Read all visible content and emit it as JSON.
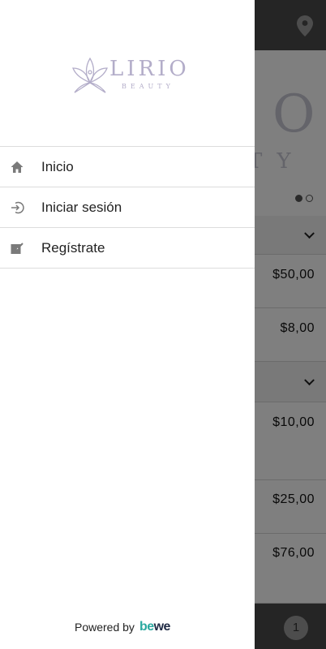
{
  "drawer": {
    "logo_text": "LIRIO",
    "logo_sub": "BEAUTY",
    "menu": [
      {
        "label": "Inicio",
        "icon": "home-icon"
      },
      {
        "label": "Iniciar sesión",
        "icon": "login-icon"
      },
      {
        "label": "Regístrate",
        "icon": "register-icon"
      }
    ],
    "powered_by": "Powered by",
    "brand_a": "be",
    "brand_b": "we"
  },
  "background": {
    "hero_o": "O",
    "hero_ty": "TY",
    "prices": [
      "$50,00",
      "$8,00",
      "$10,00",
      "$25,00",
      "$76,00"
    ],
    "cart_count": "1"
  },
  "colors": {
    "logo": "#b3adc9",
    "brand_teal": "#2aa9a0",
    "brand_dark": "#1f2a44"
  }
}
